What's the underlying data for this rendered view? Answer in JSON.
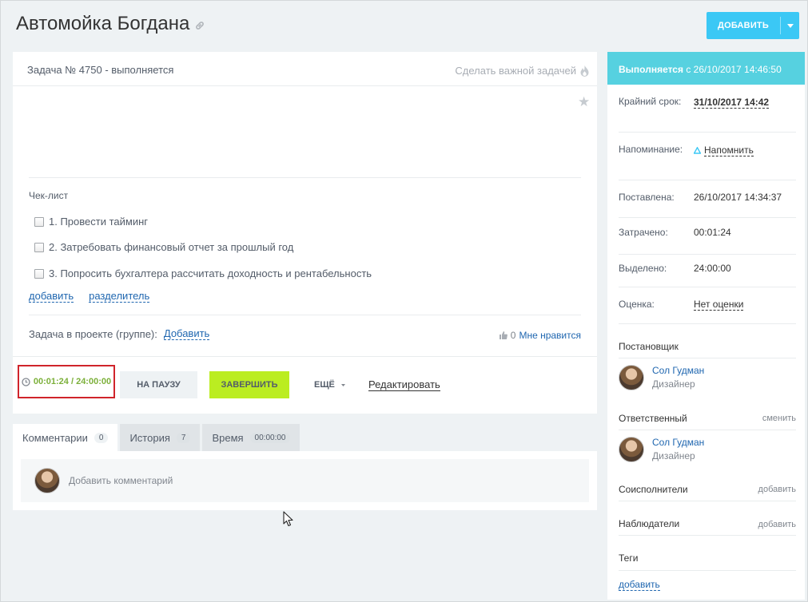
{
  "page": {
    "title": "Автомойка Богдана",
    "add_button": "ДОБАВИТЬ"
  },
  "task": {
    "header": "Задача № 4750 - выполняется",
    "make_important": "Сделать важной задачей",
    "checklist_title": "Чек-лист",
    "checklist": [
      "1. Провести тайминг",
      "2. Затребовать финансовый отчет за прошлый год",
      "3. Попросить бухгалтера рассчитать доходность и рентабельность"
    ],
    "checklist_add": "добавить",
    "checklist_separator": "разделитель",
    "project_label": "Задача в проекте (группе):",
    "project_add": "Добавить",
    "likes_count": "0",
    "likes_label": "Мне нравится"
  },
  "actions": {
    "timer": "00:01:24 / 24:00:00",
    "pause": "НА ПАУЗУ",
    "finish": "ЗАВЕРШИТЬ",
    "more": "ЕЩЁ",
    "edit": "Редактировать"
  },
  "tabs": [
    {
      "label": "Комментарии",
      "count": "0"
    },
    {
      "label": "История",
      "count": "7"
    },
    {
      "label": "Время",
      "count": "00:00:00"
    }
  ],
  "comments": {
    "placeholder": "Добавить комментарий"
  },
  "sidebar": {
    "status_bold": "Выполняется",
    "status_rest": " с 26/10/2017 14:46:50",
    "deadline_label": "Крайний срок:",
    "deadline_value": "31/10/2017 14:42",
    "reminder_label": "Напоминание:",
    "reminder_value": "Напомнить",
    "created_label": "Поставлена:",
    "created_value": "26/10/2017 14:34:37",
    "spent_label": "Затрачено:",
    "spent_value": "00:01:24",
    "allocated_label": "Выделено:",
    "allocated_value": "24:00:00",
    "rating_label": "Оценка:",
    "rating_value": "Нет оценки",
    "creator_title": "Постановщик",
    "creator_name": "Сол Гудман",
    "creator_role": "Дизайнер",
    "responsible_title": "Ответственный",
    "responsible_action": "сменить",
    "responsible_name": "Сол Гудман",
    "responsible_role": "Дизайнер",
    "coexec_title": "Соисполнители",
    "coexec_action": "добавить",
    "observers_title": "Наблюдатели",
    "observers_action": "добавить",
    "tags_title": "Теги",
    "tags_action": "добавить"
  },
  "colors": {
    "accent": "#3bc8f5",
    "status_header": "#56d1e0",
    "finish_button": "#bbed21",
    "timer_text": "#7cb03a",
    "timer_border": "#d0242b",
    "link": "#2067b0"
  }
}
